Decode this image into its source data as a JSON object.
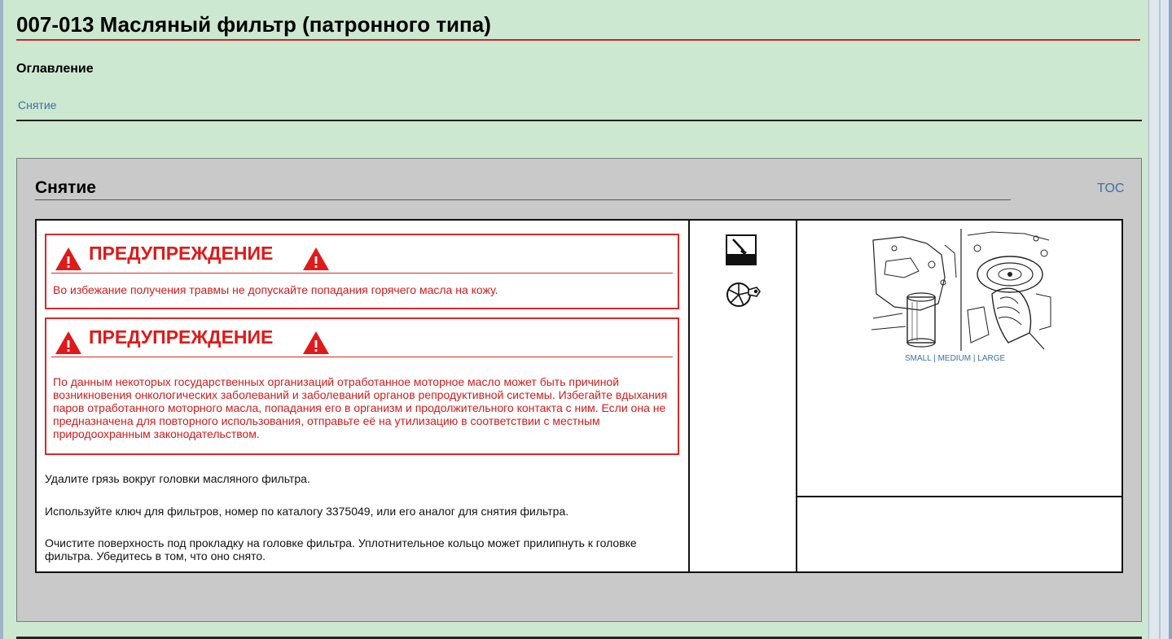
{
  "page": {
    "title": "007-013   Масляный фильтр (патронного типа)",
    "toc_heading": "Оглавление",
    "toc_links": [
      "Снятие"
    ]
  },
  "section": {
    "title": "Снятие",
    "toc_link": "TOC",
    "warnings": [
      {
        "label": "ПРЕДУПРЕЖДЕНИЕ",
        "text": "Во избежание получения травмы не допускайте попадания горячего масла на кожу."
      },
      {
        "label": "ПРЕДУПРЕЖДЕНИЕ",
        "text": "По данным некоторых государственных организаций отработанное моторное масло может быть причиной возникновения онкологических заболеваний и заболеваний органов репродуктивной системы. Избегайте вдыхания паров отработанного моторного масла, попадания его в организм и продолжительного контакта с ним. Если она не предназначена для повторного использования, отправьте её на утилизацию в соответствии с местным природоохранным законодательством."
      }
    ],
    "steps": [
      "Удалите грязь вокруг головки масляного фильтра.",
      "Используйте ключ для фильтров, номер по каталогу 3375049, или его аналог для снятия фильтра.",
      "Очистите поверхность под прокладку на головке фильтра. Уплотнительное кольцо может прилипнуть к головке фильтра. Убедитесь в том, что оно снято."
    ],
    "icons": [
      "brush-icon",
      "pie-wrench-icon"
    ],
    "image_sizes": {
      "small": "SMALL",
      "sep1": " | ",
      "medium": "MEDIUM",
      "sep2": " | ",
      "large": "LARGE"
    }
  },
  "colors": {
    "page_bg": "#cde8d0",
    "section_bg": "#c9c9c9",
    "warning_red": "#e01919",
    "link_blue": "#3d6fa8",
    "title_rule": "#c8262c"
  }
}
